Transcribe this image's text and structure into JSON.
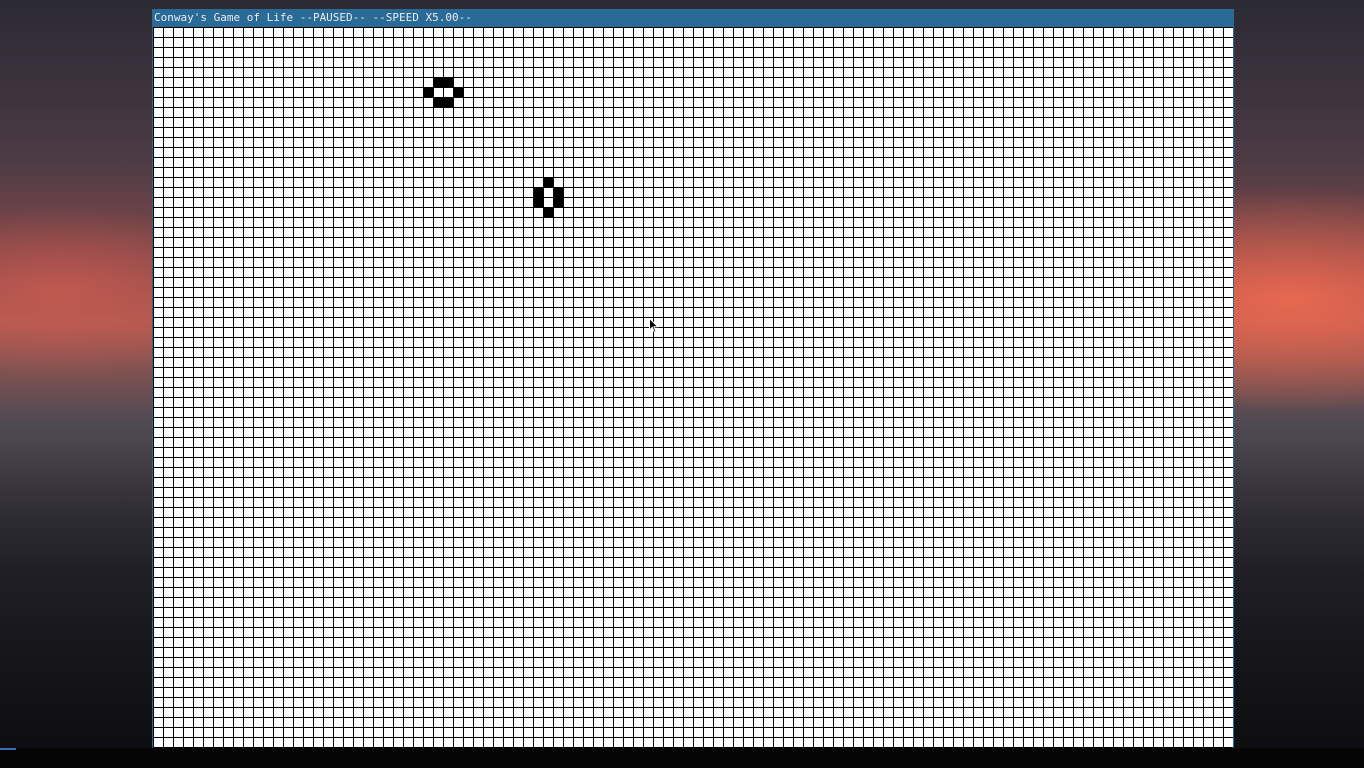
{
  "window": {
    "title": "Conway's Game of Life --PAUSED-- --SPEED X5.00--"
  },
  "board": {
    "columns": 108,
    "rows": 72,
    "live_cells": [
      {
        "col": 28,
        "row": 5
      },
      {
        "col": 29,
        "row": 5
      },
      {
        "col": 27,
        "row": 6
      },
      {
        "col": 30,
        "row": 6
      },
      {
        "col": 28,
        "row": 7
      },
      {
        "col": 29,
        "row": 7
      },
      {
        "col": 39,
        "row": 15
      },
      {
        "col": 38,
        "row": 16
      },
      {
        "col": 40,
        "row": 16
      },
      {
        "col": 38,
        "row": 17
      },
      {
        "col": 40,
        "row": 17
      },
      {
        "col": 39,
        "row": 18
      }
    ]
  },
  "icons": {
    "cursor": "mouse-pointer-icon"
  }
}
